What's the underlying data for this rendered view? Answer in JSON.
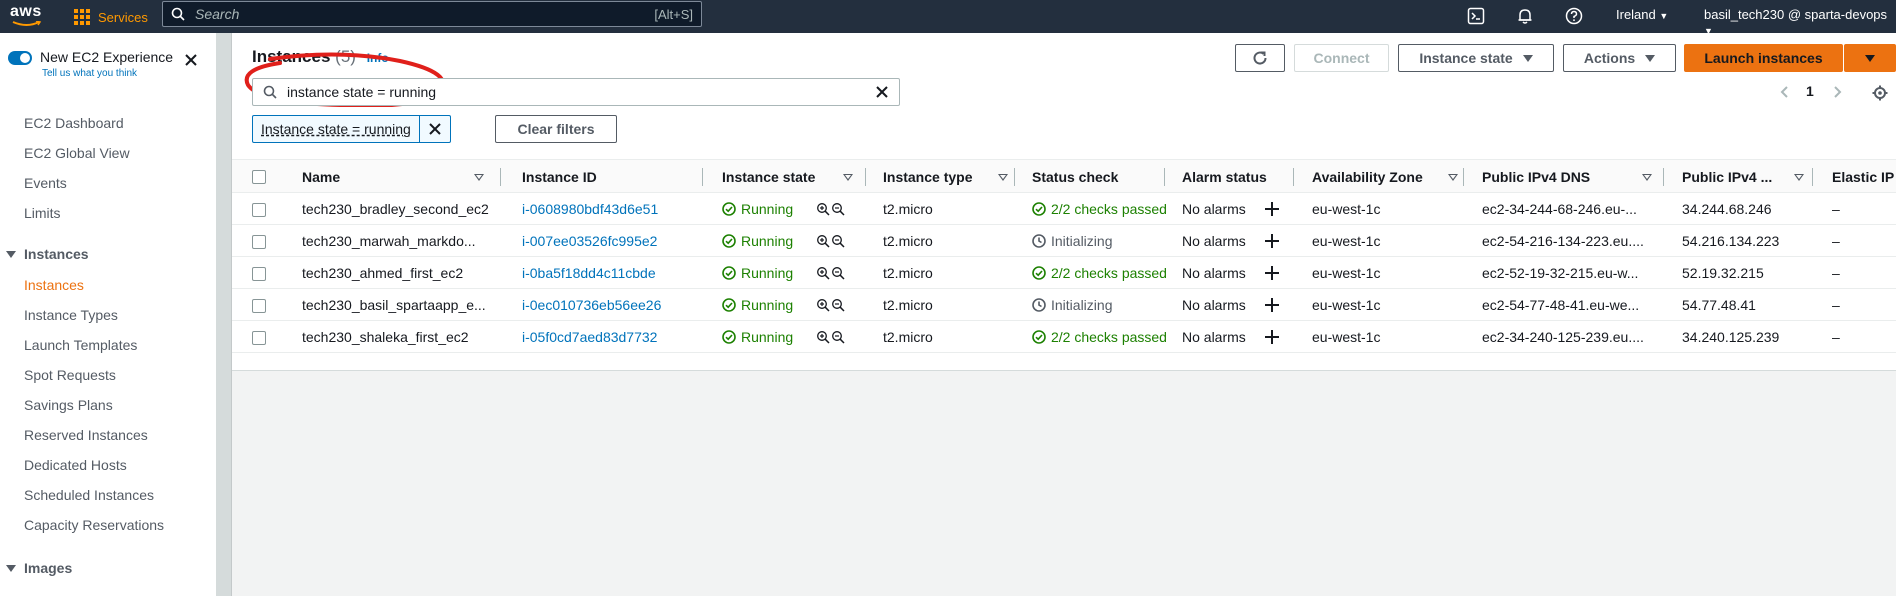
{
  "topnav": {
    "logo_text": "aws",
    "services_label": "Services",
    "search_placeholder": "Search",
    "search_shortcut": "[Alt+S]",
    "region": "Ireland",
    "account": "basil_tech230 @ sparta-devops",
    "icons": [
      "cloudshell-icon",
      "bell-icon",
      "help-icon"
    ]
  },
  "sidebar": {
    "experience_title": "New EC2 Experience",
    "experience_link": "Tell us what you think",
    "items": [
      {
        "label": "EC2 Dashboard"
      },
      {
        "label": "EC2 Global View"
      },
      {
        "label": "Events"
      },
      {
        "label": "Limits"
      }
    ],
    "section_instances": "Instances",
    "instances_items": [
      {
        "label": "Instances",
        "active": true
      },
      {
        "label": "Instance Types"
      },
      {
        "label": "Launch Templates"
      },
      {
        "label": "Spot Requests"
      },
      {
        "label": "Savings Plans"
      },
      {
        "label": "Reserved Instances"
      },
      {
        "label": "Dedicated Hosts"
      },
      {
        "label": "Scheduled Instances"
      },
      {
        "label": "Capacity Reservations"
      }
    ],
    "section_images": "Images"
  },
  "main": {
    "title": "Instances",
    "count": "(5)",
    "info": "Info",
    "buttons": {
      "connect": "Connect",
      "instance_state": "Instance state",
      "actions": "Actions",
      "launch": "Launch instances"
    },
    "filter_value": "instance state = running",
    "token_label": "Instance state = running",
    "clear_filters": "Clear filters",
    "page": "1"
  },
  "table": {
    "columns": [
      "Name",
      "Instance ID",
      "Instance state",
      "Instance type",
      "Status check",
      "Alarm status",
      "Availability Zone",
      "Public IPv4 DNS",
      "Public IPv4 ...",
      "Elastic IP"
    ],
    "rows": [
      {
        "name": "tech230_bradley_second_ec2",
        "id": "i-0608980bdf43d6e51",
        "state": "Running",
        "type": "t2.micro",
        "status": "2/2 checks passed",
        "status_ok": true,
        "alarm": "No alarms",
        "az": "eu-west-1c",
        "dns": "ec2-34-244-68-246.eu-...",
        "ipv4": "34.244.68.246",
        "eip": "–"
      },
      {
        "name": "tech230_marwah_markdo...",
        "id": "i-007ee03526fc995e2",
        "state": "Running",
        "type": "t2.micro",
        "status": "Initializing",
        "status_ok": false,
        "alarm": "No alarms",
        "az": "eu-west-1c",
        "dns": "ec2-54-216-134-223.eu....",
        "ipv4": "54.216.134.223",
        "eip": "–"
      },
      {
        "name": "tech230_ahmed_first_ec2",
        "id": "i-0ba5f18dd4c11cbde",
        "state": "Running",
        "type": "t2.micro",
        "status": "2/2 checks passed",
        "status_ok": true,
        "alarm": "No alarms",
        "az": "eu-west-1c",
        "dns": "ec2-52-19-32-215.eu-w...",
        "ipv4": "52.19.32.215",
        "eip": "–"
      },
      {
        "name": "tech230_basil_spartaapp_e...",
        "id": "i-0ec010736eb56ee26",
        "state": "Running",
        "type": "t2.micro",
        "status": "Initializing",
        "status_ok": false,
        "alarm": "No alarms",
        "az": "eu-west-1c",
        "dns": "ec2-54-77-48-41.eu-we...",
        "ipv4": "54.77.48.41",
        "eip": "–"
      },
      {
        "name": "tech230_shaleka_first_ec2",
        "id": "i-05f0cd7aed83d7732",
        "state": "Running",
        "type": "t2.micro",
        "status": "2/2 checks passed",
        "status_ok": true,
        "alarm": "No alarms",
        "az": "eu-west-1c",
        "dns": "ec2-34-240-125-239.eu....",
        "ipv4": "34.240.125.239",
        "eip": "–"
      }
    ]
  },
  "colors": {
    "nav_bg": "#232f3e",
    "accent_orange": "#ec7211",
    "link_blue": "#0073bb",
    "success_green": "#1d8102",
    "annotation_red": "#e0201b"
  }
}
